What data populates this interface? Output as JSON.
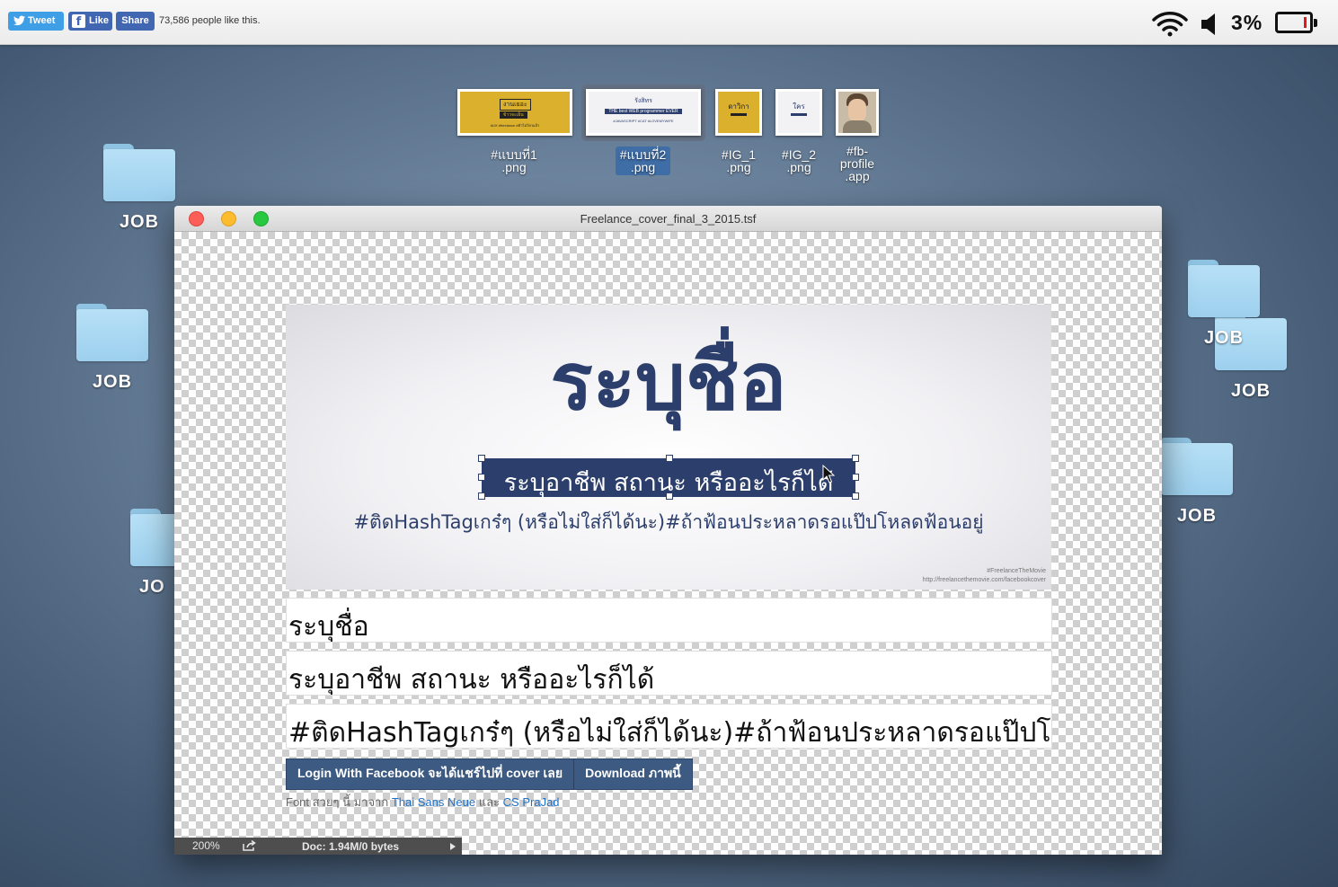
{
  "topbar": {
    "tweet_label": "Tweet",
    "like_label": "Like",
    "share_label": "Share",
    "likes_text": "73,586 people like this.",
    "battery_text": "3%",
    "battery_level_percent": 3,
    "colors": {
      "twitter": "#3e9fe6",
      "facebook": "#4267b2",
      "battery_low": "#e0191c"
    }
  },
  "desktop": {
    "folders": [
      {
        "label": "JOB"
      },
      {
        "label": "JOB"
      },
      {
        "label": "JO"
      },
      {
        "label": "JOB"
      },
      {
        "label": "JOB"
      },
      {
        "label": "JOB"
      }
    ],
    "thumbnails": [
      {
        "line1": "#แบบที่1",
        "line2": ".png",
        "preview_title": "งานเยอะ",
        "preview_sub": "ข้าวจะเย็น",
        "preview_tags": "#UX #freelance #ตัวไม่ไหวแล้ว"
      },
      {
        "line1": "#แบบที่2",
        "line2": ".png",
        "selected": true,
        "preview_title": "รังสิทร",
        "preview_sub": "THE best WEB programmer EVER",
        "preview_tags": "#JAVASCRIPT #CAT #LOVEMYWIFE"
      },
      {
        "line1": "#IG_1",
        "line2": ".png",
        "preview_title": "ดาวิกา"
      },
      {
        "line1": "#IG_2",
        "line2": ".png",
        "preview_title": "ใคร"
      },
      {
        "line1": "#fb-",
        "line2": "profile",
        "line3": ".app"
      }
    ]
  },
  "window": {
    "title": "Freelance_cover_final_3_2015.tsf",
    "cover": {
      "name": "ระบุชื่อ",
      "job": "ระบุอาชีพ สถานะ หรืออะไรก็ได้",
      "tags": "#ติดHashTagเกร๋ๆ (หรือไม่ใส่ก็ได้นะ)#ถ้าฟ้อนประหลาดรอแป๊ปโหลดฟ้อนอยู่",
      "watermark_tag": "#FreelanceTheMovie",
      "watermark_url": "http://freelancethemovie.com/facebookcover"
    },
    "fields": {
      "name_value": "ระบุชื่อ",
      "job_value": "ระบุอาชีพ สถานะ หรืออะไรก็ได้",
      "tags_value": "#ติดHashTagเกร๋ๆ (หรือไม่ใส่ก็ได้นะ)#ถ้าฟ้อนประหลาดรอแป๊ปโหลดฟ้อนอยู่"
    },
    "buttons": {
      "login_label": "Login With Facebook จะได้แชร์ไปที่ cover เลย",
      "download_label": "Download ภาพนี้"
    },
    "credit": {
      "prefix": "Font สวยๆ นี้ มาจาก",
      "font1": "Thai Sans Neue",
      "and": "และ",
      "font2": "CS PraJad"
    },
    "status": {
      "zoom": "200%",
      "doc": "Doc: 1.94M/0 bytes"
    },
    "colors": {
      "cover_navy": "#2c3e6b",
      "button_bg": "#3c5a82",
      "link": "#1f6fc5"
    }
  }
}
